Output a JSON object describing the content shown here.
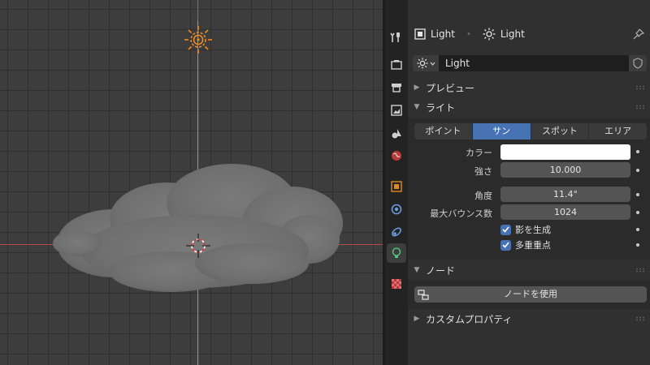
{
  "header": {
    "search_placeholder": ""
  },
  "breadcrumb": {
    "object_name": "Light",
    "data_name": "Light"
  },
  "datablock": {
    "name": "Light"
  },
  "sections": {
    "preview": "プレビュー",
    "light": "ライト",
    "nodes": "ノード",
    "custom_props": "カスタムプロパティ"
  },
  "light_types": [
    {
      "label": "ポイント",
      "active": false
    },
    {
      "label": "サン",
      "active": true
    },
    {
      "label": "スポット",
      "active": false
    },
    {
      "label": "エリア",
      "active": false
    }
  ],
  "properties": {
    "color_label": "カラー",
    "color_value": "#ffffff",
    "strength_label": "強さ",
    "strength_value": "10.000",
    "angle_label": "角度",
    "angle_value": "11.4°",
    "max_bounces_label": "最大バウンス数",
    "max_bounces_value": "1024",
    "cast_shadow_label": "影を生成",
    "cast_shadow_checked": true,
    "multiple_importance_label": "多重重点",
    "multiple_importance_checked": true
  },
  "nodes_button_label": "ノードを使用",
  "colors": {
    "accent": "#4772b3",
    "axis_x": "#b34a4a",
    "axis_z": "#e08a1c",
    "light_tab": "#51c27a",
    "object_tab": "#e08a1c"
  },
  "icons": [
    "editor-type-icon",
    "search-icon",
    "tool-icon",
    "render-icon",
    "output-icon",
    "view-layer-icon",
    "scene-icon",
    "world-icon",
    "object-icon",
    "physics-icon",
    "constraints-icon",
    "light-data-icon",
    "texture-icon",
    "sun-icon",
    "pin-icon",
    "shield-icon",
    "nodes-icon"
  ]
}
